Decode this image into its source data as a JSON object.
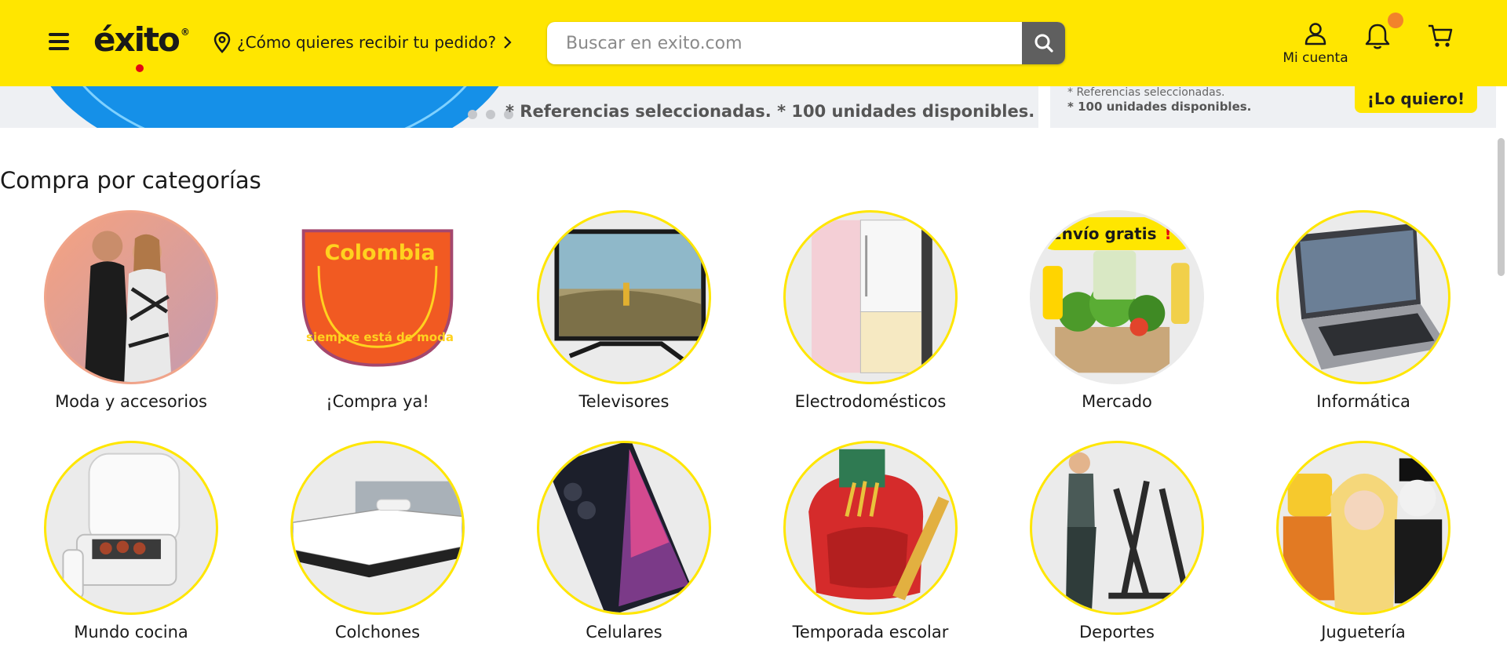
{
  "header": {
    "logo_text": "éxito",
    "logo_reg": "®",
    "delivery_prompt": "¿Cómo quieres recibir tu pedido?",
    "search_placeholder": "Buscar en exito.com",
    "account_label": "Mi cuenta",
    "brand_color": "#ffe600",
    "notification_dot_color": "#f2832b"
  },
  "banners": {
    "main_disclaimer": "* Referencias seleccionadas. * 100 unidades disponibles.",
    "carousel_dots": 3,
    "side_line1": "* Referencias seleccionadas.",
    "side_line2": "* 100 unidades disponibles.",
    "side_cta": "¡Lo quiero!"
  },
  "categories": {
    "title": "Compra por categorías",
    "shipping_badge": "Envío gratis",
    "shipping_badge_mark": "!",
    "items": [
      {
        "label": "Moda y accesorios",
        "icon": "fashion-couple-image"
      },
      {
        "label": "¡Compra ya!",
        "icon": "colombia-badge-image",
        "badge_line1": "Colombia",
        "badge_line2": "siempre está de moda"
      },
      {
        "label": "Televisores",
        "icon": "television-image"
      },
      {
        "label": "Electrodomésticos",
        "icon": "refrigerator-image"
      },
      {
        "label": "Mercado",
        "icon": "groceries-image"
      },
      {
        "label": "Informática",
        "icon": "laptop-image"
      },
      {
        "label": "Mundo cocina",
        "icon": "air-fryer-image"
      },
      {
        "label": "Colchones",
        "icon": "mattress-image"
      },
      {
        "label": "Celulares",
        "icon": "smartphone-image"
      },
      {
        "label": "Temporada escolar",
        "icon": "backpack-image"
      },
      {
        "label": "Deportes",
        "icon": "elliptical-trainer-image"
      },
      {
        "label": "Juguetería",
        "icon": "toys-image"
      }
    ]
  }
}
